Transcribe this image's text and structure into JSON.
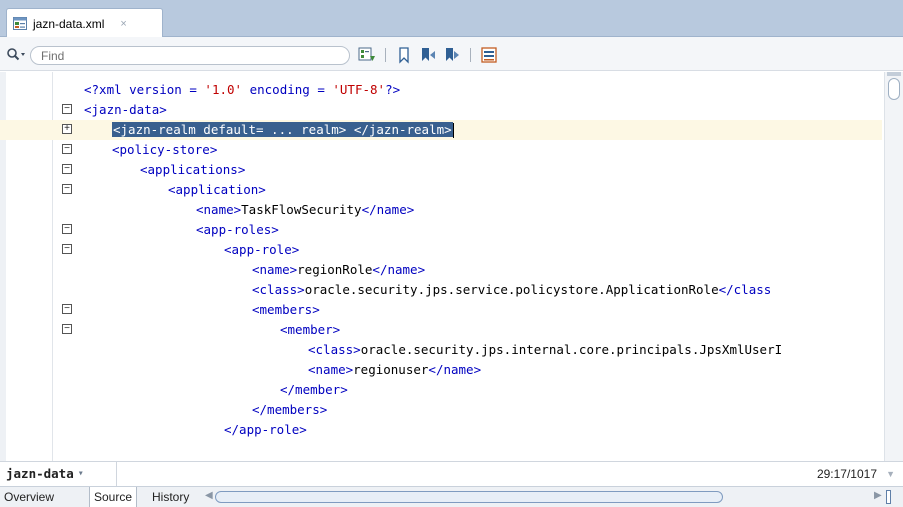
{
  "tab": {
    "label": "jazn-data.xml",
    "close_glyph": "×",
    "icon": "xml-file-icon"
  },
  "toolbar": {
    "search_placeholder": "Find",
    "search_value": "",
    "icons": [
      "search-options-icon",
      "find-next-icon",
      "bookmark-icon",
      "previous-bookmark-icon",
      "next-bookmark-icon",
      "grid-icon"
    ]
  },
  "code": {
    "lines": [
      {
        "indent": 0,
        "fold": "",
        "parts": [
          {
            "t": "<?xml version = ",
            "c": "tag"
          },
          {
            "t": "'1.0'",
            "c": "attr-val"
          },
          {
            "t": " encoding = ",
            "c": "tag"
          },
          {
            "t": "'UTF-8'",
            "c": "attr-val"
          },
          {
            "t": "?>",
            "c": "tag"
          }
        ]
      },
      {
        "indent": 0,
        "fold": "−",
        "parts": [
          {
            "t": "<jazn-data>",
            "c": "tag"
          }
        ]
      },
      {
        "indent": 1,
        "fold": "+",
        "selected": "<jazn-realm default= ... realm> </jazn-realm>",
        "highlight": true,
        "parts": []
      },
      {
        "indent": 1,
        "fold": "−",
        "parts": [
          {
            "t": "<policy-store>",
            "c": "tag"
          }
        ]
      },
      {
        "indent": 2,
        "fold": "−",
        "parts": [
          {
            "t": "<applications>",
            "c": "tag"
          }
        ]
      },
      {
        "indent": 3,
        "fold": "−",
        "parts": [
          {
            "t": "<application>",
            "c": "tag"
          }
        ]
      },
      {
        "indent": 4,
        "fold": "",
        "parts": [
          {
            "t": "<name>",
            "c": "tag"
          },
          {
            "t": "TaskFlowSecurity",
            "c": "txt"
          },
          {
            "t": "</name>",
            "c": "tag"
          }
        ]
      },
      {
        "indent": 4,
        "fold": "−",
        "parts": [
          {
            "t": "<app-roles>",
            "c": "tag"
          }
        ]
      },
      {
        "indent": 5,
        "fold": "−",
        "parts": [
          {
            "t": "<app-role>",
            "c": "tag"
          }
        ]
      },
      {
        "indent": 6,
        "fold": "",
        "parts": [
          {
            "t": "<name>",
            "c": "tag"
          },
          {
            "t": "regionRole",
            "c": "txt"
          },
          {
            "t": "</name>",
            "c": "tag"
          }
        ]
      },
      {
        "indent": 6,
        "fold": "",
        "parts": [
          {
            "t": "<class>",
            "c": "tag"
          },
          {
            "t": "oracle.security.jps.service.policystore.ApplicationRole",
            "c": "txt"
          },
          {
            "t": "</class",
            "c": "tag"
          }
        ]
      },
      {
        "indent": 6,
        "fold": "−",
        "parts": [
          {
            "t": "<members>",
            "c": "tag"
          }
        ]
      },
      {
        "indent": 7,
        "fold": "−",
        "parts": [
          {
            "t": "<member>",
            "c": "tag"
          }
        ]
      },
      {
        "indent": 8,
        "fold": "",
        "parts": [
          {
            "t": "<class>",
            "c": "tag"
          },
          {
            "t": "oracle.security.jps.internal.core.principals.JpsXmlUserI",
            "c": "txt"
          }
        ]
      },
      {
        "indent": 8,
        "fold": "",
        "parts": [
          {
            "t": "<name>",
            "c": "tag"
          },
          {
            "t": "regionuser",
            "c": "txt"
          },
          {
            "t": "</name>",
            "c": "tag"
          }
        ]
      },
      {
        "indent": 7,
        "fold": "",
        "parts": [
          {
            "t": "</member>",
            "c": "tag"
          }
        ]
      },
      {
        "indent": 6,
        "fold": "",
        "parts": [
          {
            "t": "</members>",
            "c": "tag"
          }
        ]
      },
      {
        "indent": 5,
        "fold": "",
        "parts": [
          {
            "t": "</app-role>",
            "c": "tag"
          }
        ]
      }
    ]
  },
  "status": {
    "breadcrumb": "jazn-data",
    "breadcrumb_arrow": "▾",
    "position": "29:17/1017"
  },
  "bottom_tabs": [
    "Overview",
    "Source",
    "History"
  ],
  "active_bottom_tab": "Source"
}
